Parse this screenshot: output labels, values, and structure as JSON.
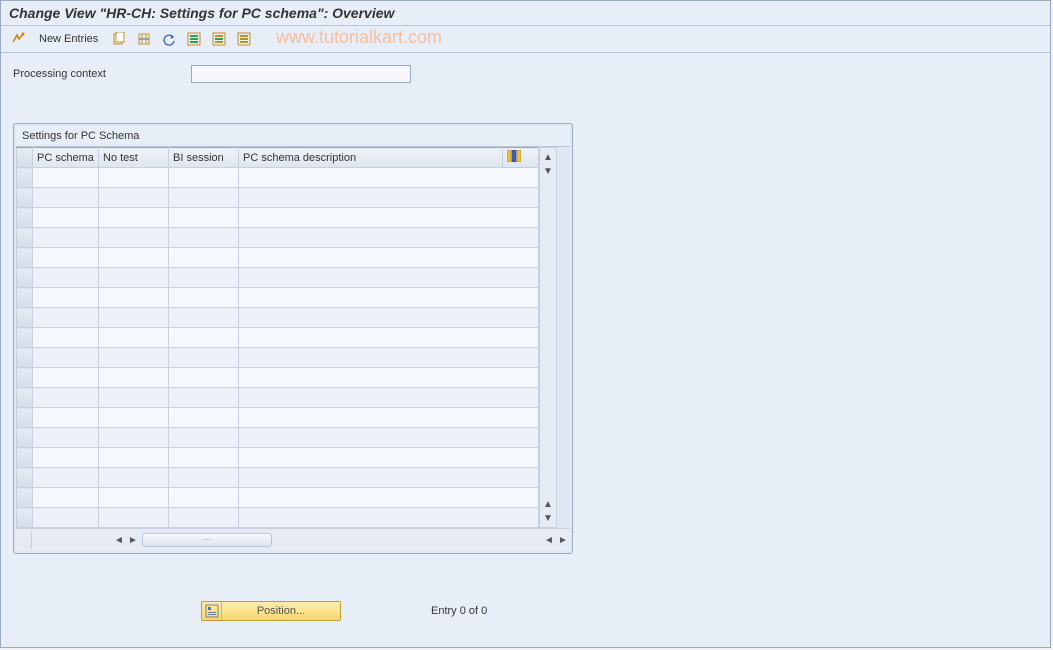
{
  "title": "Change View \"HR-CH: Settings for PC schema\": Overview",
  "watermark": "www.tutorialkart.com",
  "toolbar": {
    "new_entries": "New Entries"
  },
  "form": {
    "processing_context_label": "Processing context",
    "processing_context_value": ""
  },
  "table": {
    "title": "Settings for PC Schema",
    "columns": {
      "pc_schema": "PC schema",
      "no_test": "No test",
      "bi_session": "BI session",
      "desc": "PC schema description"
    },
    "rows": 18
  },
  "footer": {
    "position_label": "Position...",
    "entry_status": "Entry 0 of 0"
  }
}
